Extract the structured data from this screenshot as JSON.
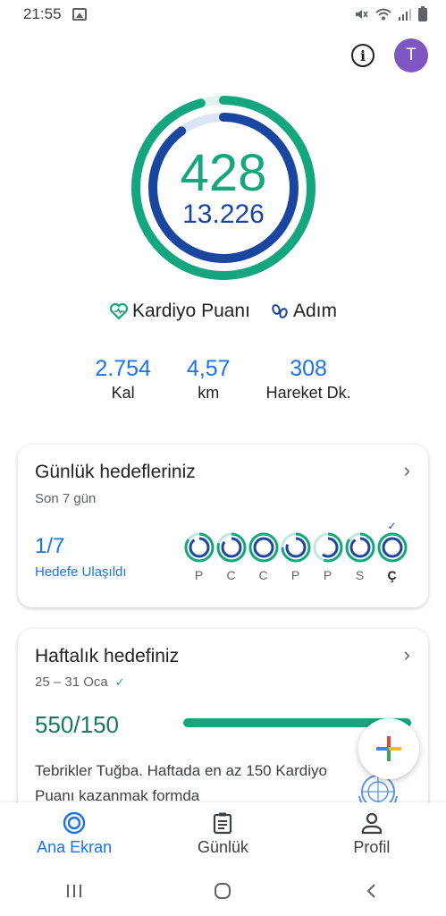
{
  "status_bar": {
    "time": "21:55"
  },
  "header": {
    "avatar_initial": "T"
  },
  "ring": {
    "cardio_points": "428",
    "steps": "13.226",
    "cardio_color": "#15a57f",
    "steps_color": "#1a46a0"
  },
  "legend": {
    "cardio_label": "Kardiyo Puanı",
    "steps_label": "Adım"
  },
  "stats": [
    {
      "value": "2.754",
      "label": "Kal"
    },
    {
      "value": "4,57",
      "label": "km"
    },
    {
      "value": "308",
      "label": "Hareket Dk."
    }
  ],
  "daily_goals": {
    "title": "Günlük hedefleriniz",
    "subtitle": "Son 7 gün",
    "count": "1/7",
    "count_label": "Hedefe Ulaşıldı",
    "days": [
      {
        "label": "P",
        "progress": 0.85,
        "today": false
      },
      {
        "label": "C",
        "progress": 0.8,
        "today": false
      },
      {
        "label": "C",
        "progress": 1.0,
        "today": false
      },
      {
        "label": "P",
        "progress": 0.75,
        "today": false
      },
      {
        "label": "P",
        "progress": 0.55,
        "today": false
      },
      {
        "label": "S",
        "progress": 0.85,
        "today": false
      },
      {
        "label": "Ç",
        "progress": 1.0,
        "today": true
      }
    ]
  },
  "weekly_goal": {
    "title": "Haftalık hedefiniz",
    "date_range": "25 – 31 Oca",
    "score": "550/150",
    "progress": 1.0,
    "message": "Tebrikler Tuğba. Haftada en az 150 Kardiyo Puanı kazanmak formda"
  },
  "bottom_nav": [
    {
      "label": "Ana Ekran",
      "icon": "home-ring-icon",
      "active": true
    },
    {
      "label": "Günlük",
      "icon": "journal-icon",
      "active": false
    },
    {
      "label": "Profil",
      "icon": "person-icon",
      "active": false
    }
  ],
  "colors": {
    "accent_blue": "#1a73e8",
    "cardio_green": "#15a57f",
    "steps_navy": "#1a46a0"
  }
}
